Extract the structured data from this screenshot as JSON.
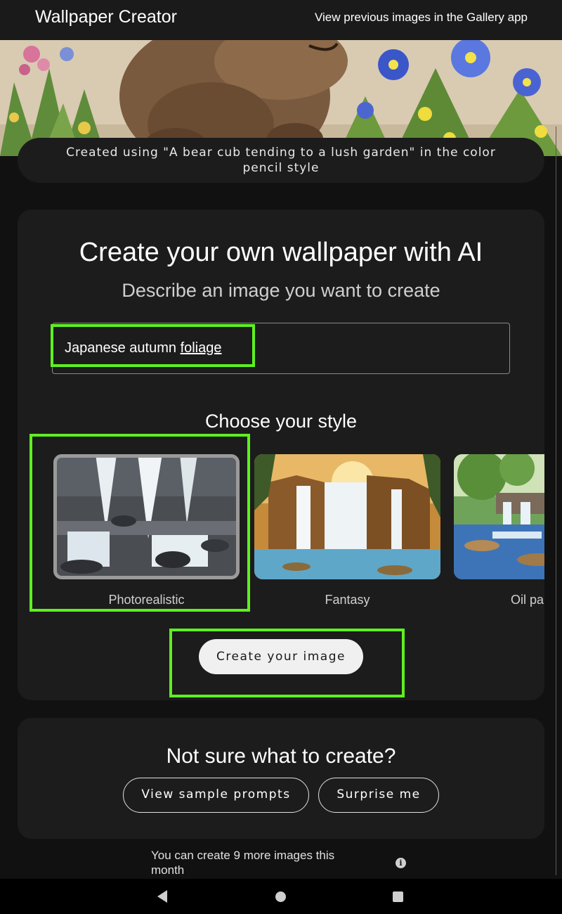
{
  "app": {
    "title": "Wallpaper Creator",
    "gallery_link": "View previous images in the Gallery app"
  },
  "hero": {
    "caption": "Created using \"A bear cub tending to a lush garden\" in the color pencil style"
  },
  "create_card": {
    "heading": "Create your own wallpaper with AI",
    "subheading": "Describe an image you want to create",
    "prompt_value_part1": "Japanese autumn ",
    "prompt_value_part2": "foliage",
    "style_heading": "Choose your style",
    "styles": [
      {
        "label": "Photorealistic",
        "selected": true
      },
      {
        "label": "Fantasy",
        "selected": false
      },
      {
        "label": "Oil pa",
        "selected": false
      }
    ],
    "create_button": "Create your image"
  },
  "help_card": {
    "heading": "Not sure what to create?",
    "sample_prompts_button": "View sample prompts",
    "surprise_button": "Surprise me"
  },
  "quota_text": "You can create 9 more images this month",
  "icons": {
    "info": "info-icon",
    "back": "back-icon",
    "home": "home-icon",
    "recents": "recents-icon"
  },
  "colors": {
    "background": "#111111",
    "card": "#1c1c1c",
    "highlight": "#5ef020",
    "button_light": "#f0f0f0"
  }
}
